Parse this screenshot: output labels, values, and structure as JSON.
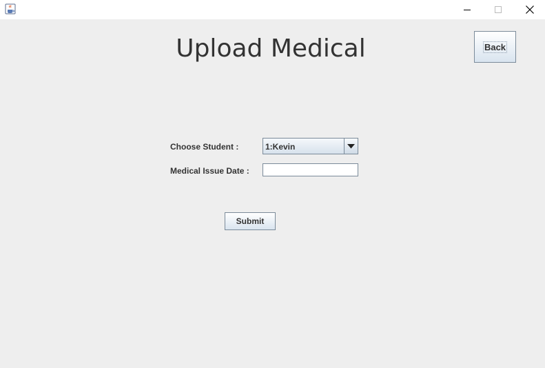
{
  "window": {
    "icon": "java-cup-icon",
    "controls": {
      "minimize": "minimize-icon",
      "maximize": "maximize-icon",
      "close": "close-icon"
    }
  },
  "page": {
    "title": "Upload Medical"
  },
  "toolbar": {
    "back_label": "Back"
  },
  "form": {
    "student_label": "Choose Student :",
    "student_selected": "1:Kevin",
    "date_label": "Medical Issue Date :",
    "date_value": ""
  },
  "actions": {
    "submit_label": "Submit"
  },
  "colors": {
    "background": "#eeeeee",
    "titlebar": "#ffffff",
    "button_border": "#7a8a99",
    "text": "#333333"
  }
}
